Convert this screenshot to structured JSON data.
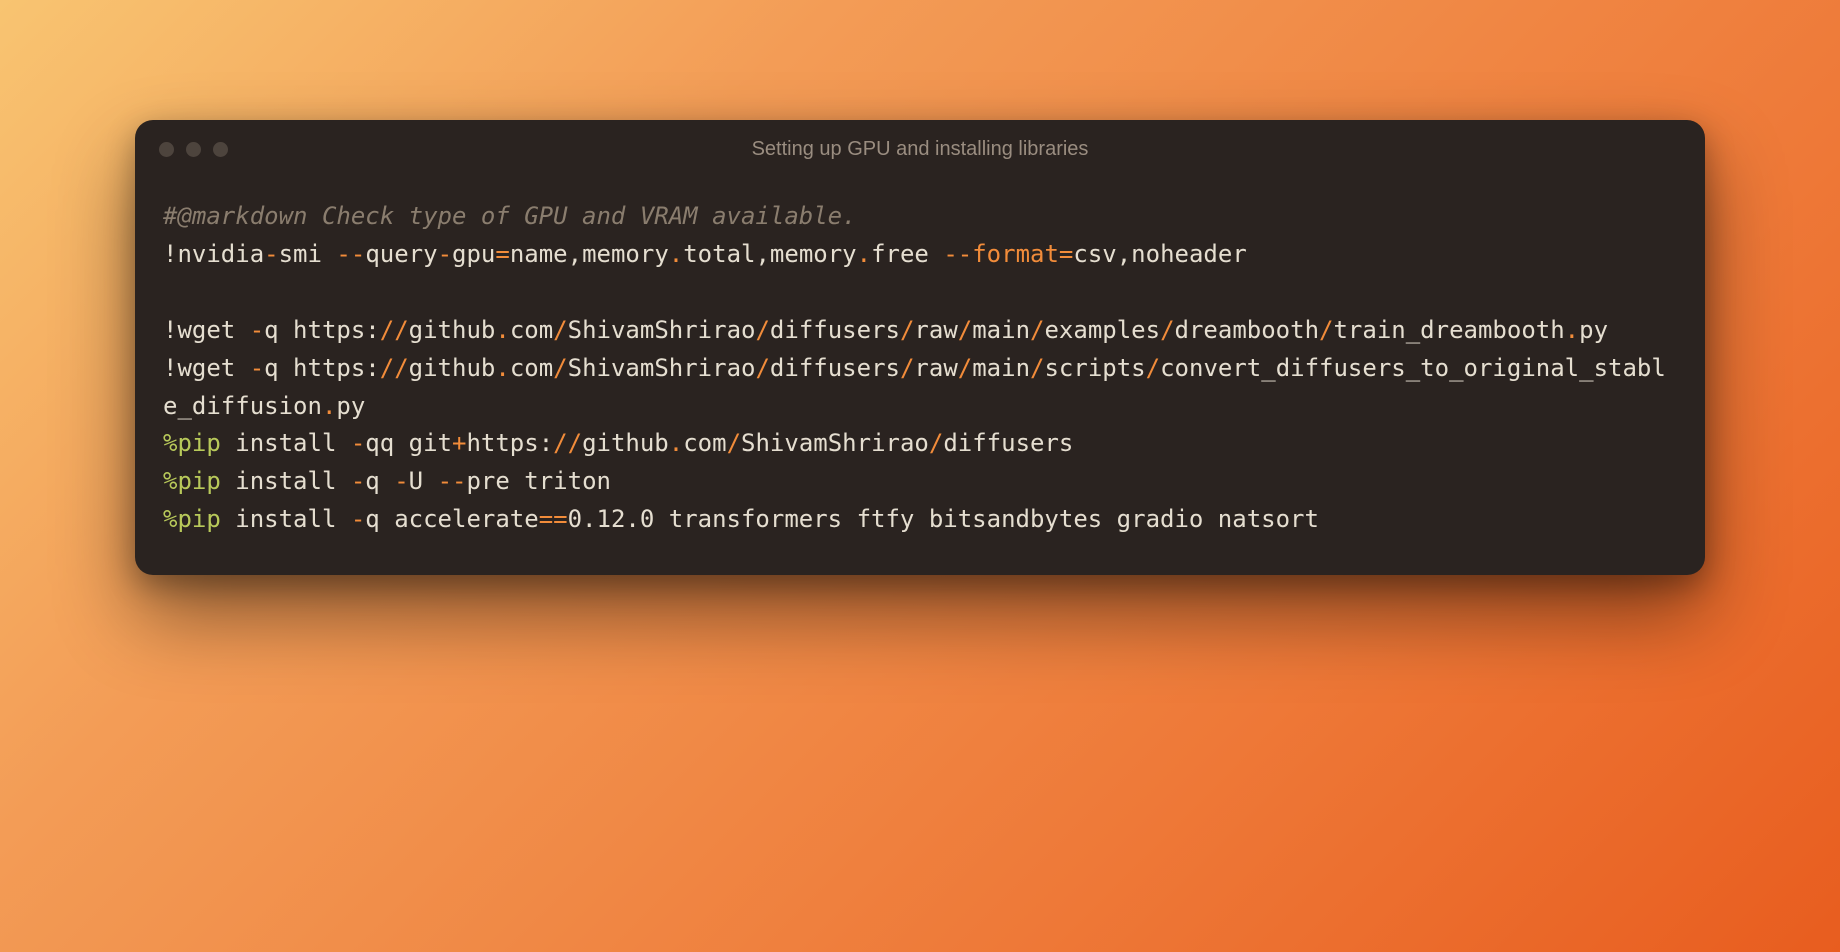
{
  "window": {
    "title": "Setting up GPU and installing libraries"
  },
  "tokens": [
    {
      "cls": "comment",
      "t": "#@markdown Check type of GPU and VRAM available."
    },
    {
      "cls": "br"
    },
    {
      "cls": "plain",
      "t": "!nvidia"
    },
    {
      "cls": "op",
      "t": "-"
    },
    {
      "cls": "plain",
      "t": "smi "
    },
    {
      "cls": "op",
      "t": "--"
    },
    {
      "cls": "plain",
      "t": "query"
    },
    {
      "cls": "op",
      "t": "-"
    },
    {
      "cls": "plain",
      "t": "gpu"
    },
    {
      "cls": "op",
      "t": "="
    },
    {
      "cls": "plain",
      "t": "name,memory"
    },
    {
      "cls": "op",
      "t": "."
    },
    {
      "cls": "plain",
      "t": "total,memory"
    },
    {
      "cls": "op",
      "t": "."
    },
    {
      "cls": "plain",
      "t": "free "
    },
    {
      "cls": "op",
      "t": "--format="
    },
    {
      "cls": "plain",
      "t": "csv,noheader"
    },
    {
      "cls": "br"
    },
    {
      "cls": "br"
    },
    {
      "cls": "plain",
      "t": "!wget "
    },
    {
      "cls": "op",
      "t": "-"
    },
    {
      "cls": "plain",
      "t": "q https:"
    },
    {
      "cls": "op",
      "t": "//"
    },
    {
      "cls": "plain",
      "t": "github"
    },
    {
      "cls": "op",
      "t": "."
    },
    {
      "cls": "plain",
      "t": "com"
    },
    {
      "cls": "op",
      "t": "/"
    },
    {
      "cls": "plain",
      "t": "ShivamShrirao"
    },
    {
      "cls": "op",
      "t": "/"
    },
    {
      "cls": "plain",
      "t": "diffusers"
    },
    {
      "cls": "op",
      "t": "/"
    },
    {
      "cls": "plain",
      "t": "raw"
    },
    {
      "cls": "op",
      "t": "/"
    },
    {
      "cls": "plain",
      "t": "main"
    },
    {
      "cls": "op",
      "t": "/"
    },
    {
      "cls": "plain",
      "t": "examples"
    },
    {
      "cls": "op",
      "t": "/"
    },
    {
      "cls": "plain",
      "t": "dreambooth"
    },
    {
      "cls": "op",
      "t": "/"
    },
    {
      "cls": "plain",
      "t": "train_dreambooth"
    },
    {
      "cls": "op",
      "t": "."
    },
    {
      "cls": "plain",
      "t": "py"
    },
    {
      "cls": "br"
    },
    {
      "cls": "plain",
      "t": "!wget "
    },
    {
      "cls": "op",
      "t": "-"
    },
    {
      "cls": "plain",
      "t": "q https:"
    },
    {
      "cls": "op",
      "t": "//"
    },
    {
      "cls": "plain",
      "t": "github"
    },
    {
      "cls": "op",
      "t": "."
    },
    {
      "cls": "plain",
      "t": "com"
    },
    {
      "cls": "op",
      "t": "/"
    },
    {
      "cls": "plain",
      "t": "ShivamShrirao"
    },
    {
      "cls": "op",
      "t": "/"
    },
    {
      "cls": "plain",
      "t": "diffusers"
    },
    {
      "cls": "op",
      "t": "/"
    },
    {
      "cls": "plain",
      "t": "raw"
    },
    {
      "cls": "op",
      "t": "/"
    },
    {
      "cls": "plain",
      "t": "main"
    },
    {
      "cls": "op",
      "t": "/"
    },
    {
      "cls": "plain",
      "t": "scripts"
    },
    {
      "cls": "op",
      "t": "/"
    },
    {
      "cls": "plain",
      "t": "convert_diffusers_to_original_stable_diffusion"
    },
    {
      "cls": "op",
      "t": "."
    },
    {
      "cls": "plain",
      "t": "py"
    },
    {
      "cls": "br"
    },
    {
      "cls": "pip",
      "t": "%pip"
    },
    {
      "cls": "plain",
      "t": " install "
    },
    {
      "cls": "op",
      "t": "-"
    },
    {
      "cls": "plain",
      "t": "qq git"
    },
    {
      "cls": "op",
      "t": "+"
    },
    {
      "cls": "plain",
      "t": "https:"
    },
    {
      "cls": "op",
      "t": "//"
    },
    {
      "cls": "plain",
      "t": "github"
    },
    {
      "cls": "op",
      "t": "."
    },
    {
      "cls": "plain",
      "t": "com"
    },
    {
      "cls": "op",
      "t": "/"
    },
    {
      "cls": "plain",
      "t": "ShivamShrirao"
    },
    {
      "cls": "op",
      "t": "/"
    },
    {
      "cls": "plain",
      "t": "diffusers"
    },
    {
      "cls": "br"
    },
    {
      "cls": "pip",
      "t": "%pip"
    },
    {
      "cls": "plain",
      "t": " install "
    },
    {
      "cls": "op",
      "t": "-"
    },
    {
      "cls": "plain",
      "t": "q "
    },
    {
      "cls": "op",
      "t": "-"
    },
    {
      "cls": "plain",
      "t": "U "
    },
    {
      "cls": "op",
      "t": "--"
    },
    {
      "cls": "plain",
      "t": "pre triton"
    },
    {
      "cls": "br"
    },
    {
      "cls": "pip",
      "t": "%pip"
    },
    {
      "cls": "plain",
      "t": " install "
    },
    {
      "cls": "op",
      "t": "-"
    },
    {
      "cls": "plain",
      "t": "q accelerate"
    },
    {
      "cls": "op",
      "t": "=="
    },
    {
      "cls": "plain",
      "t": "0.12.0 transformers ftfy bitsandbytes gradio natsort"
    }
  ]
}
